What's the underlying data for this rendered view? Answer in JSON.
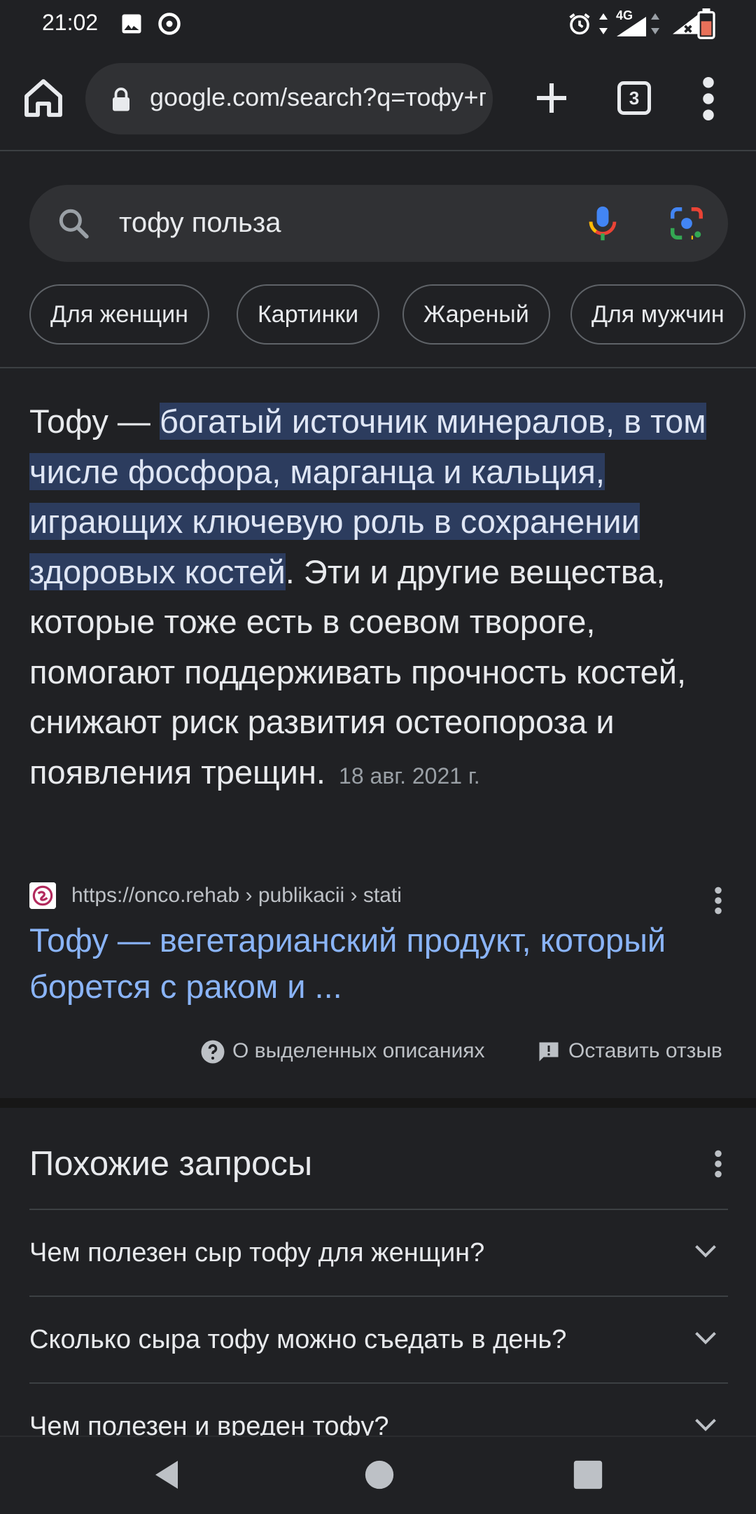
{
  "status_bar": {
    "time": "21:02",
    "network": "4G",
    "icons": [
      "image-icon",
      "media-icon",
      "alarm-icon",
      "data-arrows-icon",
      "signal-icon",
      "signal-x-icon",
      "battery-icon"
    ]
  },
  "browser": {
    "url": "google.com/search?q=тофу+г",
    "tab_count": "3",
    "icons": [
      "home-icon",
      "lock-icon",
      "plus-icon",
      "tabs-icon",
      "more-vert-icon"
    ]
  },
  "search": {
    "query": "тофу польза",
    "icons": [
      "search-icon",
      "mic-icon",
      "lens-icon"
    ]
  },
  "chips": [
    "Для женщин",
    "Картинки",
    "Жареный",
    "Для мужчин"
  ],
  "featured_snippet": {
    "prefix": "Тофу — ",
    "highlight": "богатый источник минералов, в том числе фосфора, марганца и кальция, играющих ключевую роль в сохранении здоровых костей",
    "rest": ". Эти и другие вещества, которые тоже есть в соевом твороге, помогают поддерживать прочность костей, снижают риск развития остеопороза и появления трещин.",
    "date": "18 авг. 2021 г.",
    "source_url": "https://onco.rehab › publikacii › stati",
    "result_title": "Тофу — вегетарианский продукт, который борется с раком и ...",
    "about_label": "О выделенных описаниях",
    "feedback_label": "Оставить отзыв"
  },
  "related": {
    "title": "Похожие запросы",
    "items": [
      "Чем полезен сыр тофу для женщин?",
      "Сколько сыра тофу можно съедать в день?",
      "Чем полезен и вреден тофу?"
    ]
  }
}
